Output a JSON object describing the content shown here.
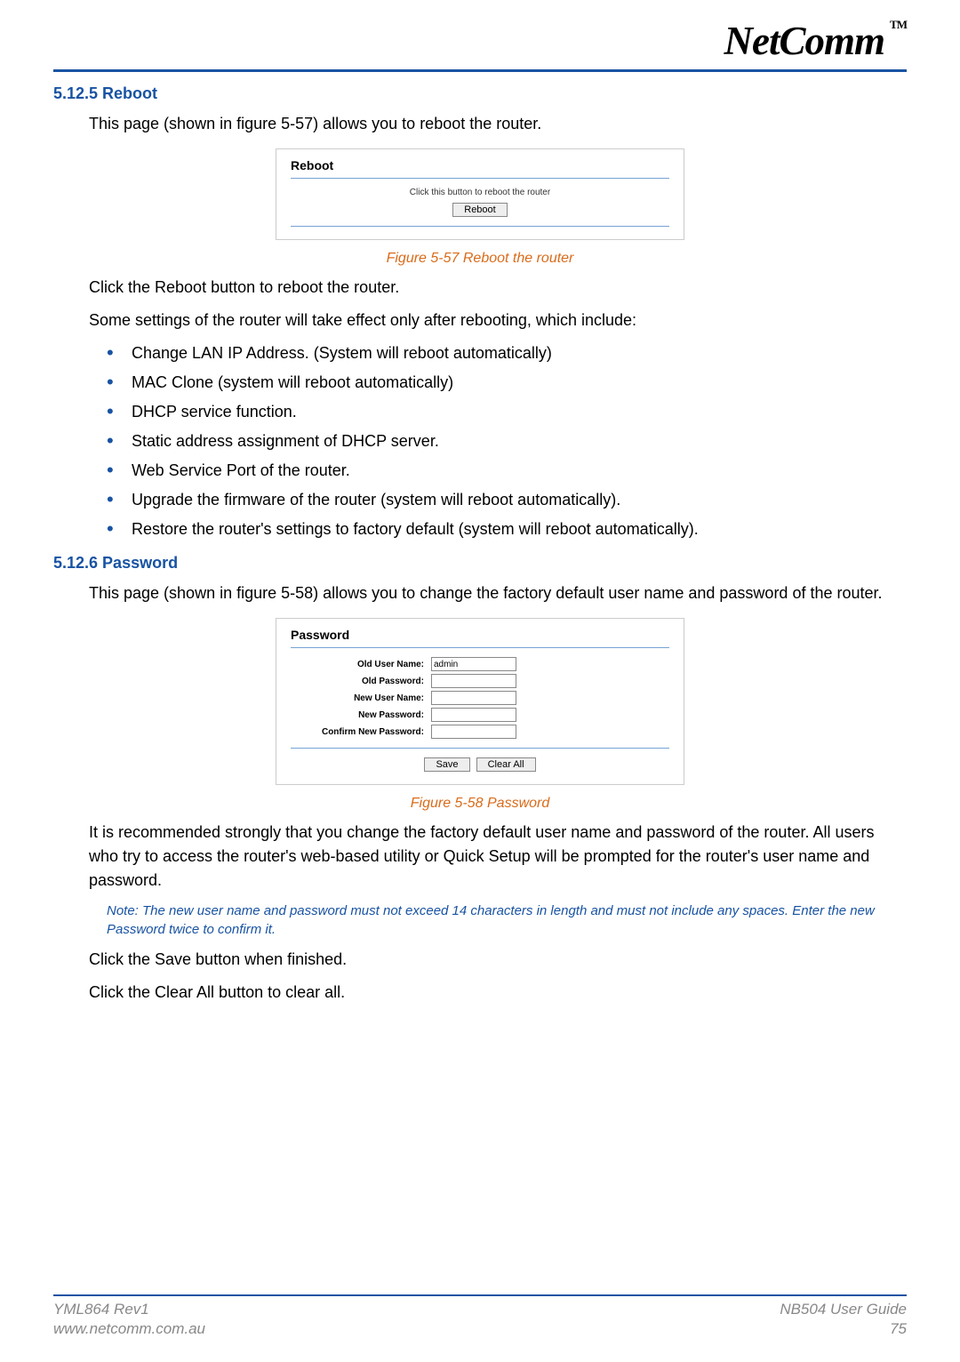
{
  "brand": {
    "name": "NetComm",
    "tm": "TM"
  },
  "sections": {
    "reboot": {
      "heading": "5.12.5 Reboot",
      "intro": "This page (shown in figure 5-57) allows you to reboot the router.",
      "panel": {
        "title": "Reboot",
        "hint": "Click this button to reboot the router",
        "button": "Reboot"
      },
      "caption": "Figure 5-57 Reboot the router",
      "para1": "Click the Reboot button to reboot the router.",
      "para2": "Some settings of the router will take effect only after rebooting, which include:",
      "bullets": [
        "Change LAN IP Address. (System will reboot automatically)",
        "MAC Clone (system will reboot automatically)",
        "DHCP service function.",
        "Static address assignment of DHCP server.",
        "Web Service Port of the router.",
        "Upgrade the firmware of the router (system will reboot automatically).",
        "Restore the router's settings to factory default (system will reboot automatically)."
      ]
    },
    "password": {
      "heading": "5.12.6 Password",
      "intro": "This page (shown in figure 5-58) allows you to change the factory default user name and password of the router.",
      "panel": {
        "title": "Password",
        "fields": {
          "old_user": {
            "label": "Old User Name:",
            "value": "admin"
          },
          "old_pass": {
            "label": "Old Password:",
            "value": ""
          },
          "new_user": {
            "label": "New User Name:",
            "value": ""
          },
          "new_pass": {
            "label": "New Password:",
            "value": ""
          },
          "confirm": {
            "label": "Confirm New Password:",
            "value": ""
          }
        },
        "save": "Save",
        "clear": "Clear All"
      },
      "caption": "Figure 5-58 Password",
      "para1": "It is recommended strongly that you change the factory default user name and password of the router. All users who try to access the router's web-based utility or Quick Setup will be prompted for the router's user name and password.",
      "note": "Note: The new user name and password must not exceed 14 characters in length and must not include any spaces. Enter the new Password twice to confirm it.",
      "para2": "Click the Save button when finished.",
      "para3": "Click the Clear All button to clear all."
    }
  },
  "footer": {
    "left1": "YML864 Rev1",
    "left2": "www.netcomm.com.au",
    "right1": "NB504 User Guide",
    "right2": "75"
  }
}
